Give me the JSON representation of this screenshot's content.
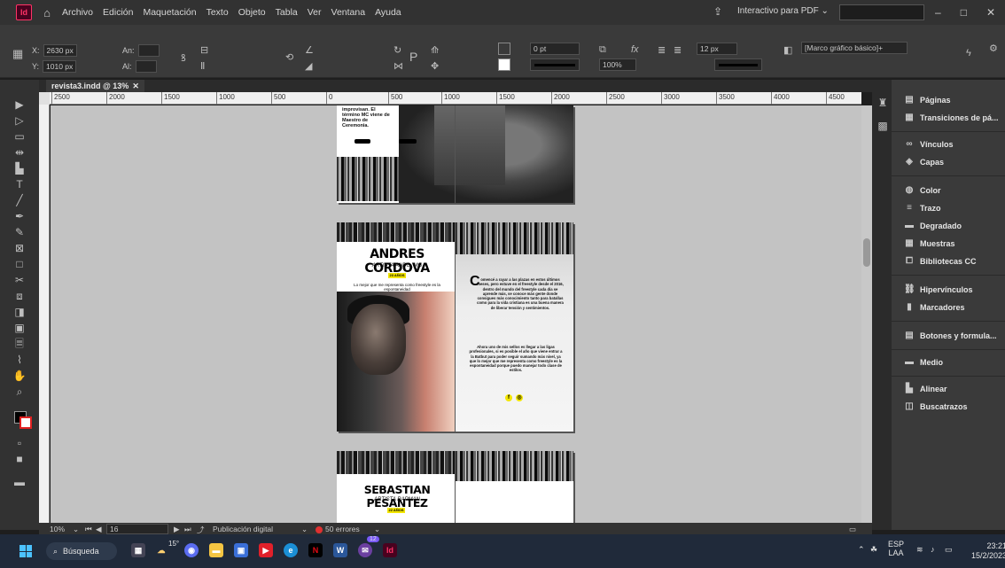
{
  "menubar": {
    "logo": "Id",
    "items": [
      "Archivo",
      "Edición",
      "Maquetación",
      "Texto",
      "Objeto",
      "Tabla",
      "Ver",
      "Ventana",
      "Ayuda"
    ],
    "workspace": "Interactivo para PDF",
    "window_controls": [
      "–",
      "□",
      "✕"
    ]
  },
  "control": {
    "x_label": "X:",
    "x_value": "2630 px",
    "y_label": "Y:",
    "y_value": "1010 px",
    "w_label": "An:",
    "h_label": "Al:",
    "stroke_weight": "0 pt",
    "opacity": "100%",
    "column_gutter": "12 px",
    "frame_style": "[Marco gráfico básico]+",
    "fill_color": "#000000",
    "stroke_color": "#ffffff"
  },
  "document": {
    "tab_title": "revista3.indd @ 13%",
    "tab_close": "✕"
  },
  "ruler": {
    "labels": [
      "2500",
      "2000",
      "1500",
      "1000",
      "500",
      "0",
      "500",
      "1000",
      "1500",
      "2000",
      "2500",
      "3000",
      "3500",
      "4000",
      "4500"
    ]
  },
  "spread1": {
    "text": "improvisan. El término MC viene de Maestro de Ceremonia."
  },
  "spread2": {
    "title": "ANDRES CORDOVA",
    "subtitle": "ARTISTA ANDO_MG",
    "tag": "23 AÑOS",
    "quote": "Lo mejor que me representa como freestyle es la espontaneidad",
    "dropcap": "C",
    "body1": "omencé a rayar a las plazas en estos últimos meses, pero estuve en el freestyle desde el 2016, dentro del mundo del freestyle cada día se aprende más, se conoce más gente donde consigues más conocimiento tanto para batallas como para la vida cristiana es una buena manera de liberar tensión y sentimientos.",
    "body2": "Ahora uno de mis sellos es llegar a las ligas profesionales, si es posible el año que viene entrar a la Batbut para poder seguir sumando más nivel, ya que lo mejor que me representa como freestyle es la espontaneidad porque puedo manejar todo clase de estilos.",
    "social": [
      "f",
      "◎"
    ]
  },
  "spread3": {
    "title": "SEBASTIAN PESANTEZ",
    "subtitle": "ARTISTA RAPMAN",
    "tag": "22 AÑOS"
  },
  "status": {
    "zoom": "10%",
    "page": "16",
    "mode": "Publicación digital",
    "errors": "50 errores"
  },
  "panel": {
    "items": [
      "Páginas",
      "Transiciones de pá...",
      "Vínculos",
      "Capas",
      "Color",
      "Trazo",
      "Degradado",
      "Muestras",
      "Bibliotecas CC",
      "Hipervínculos",
      "Marcadores",
      "Botones y formula...",
      "Medio",
      "Alinear",
      "Buscatrazos"
    ]
  },
  "taskbar": {
    "search": "Búsqueda",
    "weather": "15°",
    "notif_count": "12",
    "lang": "ESP",
    "lang2": "LAA",
    "time": "23:21",
    "date": "15/2/2023"
  }
}
